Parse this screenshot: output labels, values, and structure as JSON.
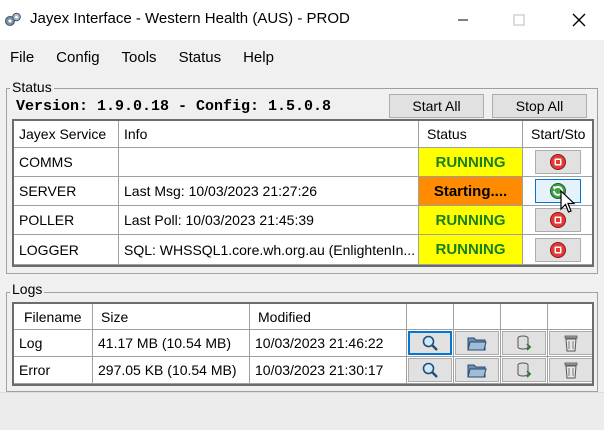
{
  "window": {
    "title": "Jayex Interface - Western Health (AUS) - PROD",
    "app_icon": "gears-icon",
    "minimize_icon": "minimize-icon",
    "maximize_icon": "maximize-icon",
    "close_icon": "close-icon"
  },
  "menu": {
    "items": [
      "File",
      "Config",
      "Tools",
      "Status",
      "Help"
    ]
  },
  "status_group": {
    "label": "Status",
    "version_line": "Version: 1.9.0.18 - Config: 1.5.0.8",
    "start_all_label": "Start All",
    "stop_all_label": "Stop All",
    "columns": [
      "Jayex Service",
      "Info",
      "Status",
      "Start/Sto"
    ],
    "rows": [
      {
        "service": "COMMS",
        "info": "",
        "status": "RUNNING",
        "status_color": "#ffff00",
        "action_icon": "stop-icon"
      },
      {
        "service": "SERVER",
        "info": "Last Msg: 10/03/2023 21:27:26",
        "status": "Starting....",
        "status_color": "#ff8c00",
        "action_icon": "start-icon"
      },
      {
        "service": "POLLER",
        "info": "Last Poll: 10/03/2023 21:45:39",
        "status": "RUNNING",
        "status_color": "#ffff00",
        "action_icon": "stop-icon"
      },
      {
        "service": "LOGGER",
        "info": "SQL: WHSSQL1.core.wh.org.au (EnlightenIn...",
        "status": "RUNNING",
        "status_color": "#ffff00",
        "action_icon": "stop-icon"
      }
    ]
  },
  "logs_group": {
    "label": "Logs",
    "columns": [
      "Filename",
      "Size",
      "Modified"
    ],
    "rows": [
      {
        "filename": "Log",
        "size": "41.17 MB (10.54 MB)",
        "modified": "10/03/2023 21:46:22"
      },
      {
        "filename": "Error",
        "size": "297.05 KB (10.54 MB)",
        "modified": "10/03/2023 21:30:17"
      }
    ],
    "action_icons": [
      "view-icon",
      "open-folder-icon",
      "archive-icon",
      "delete-icon"
    ]
  },
  "colors": {
    "running_text": "#1a7f1a",
    "running_bg": "#ffff00",
    "starting_bg": "#ff8c00",
    "focus_border": "#0078d7"
  }
}
